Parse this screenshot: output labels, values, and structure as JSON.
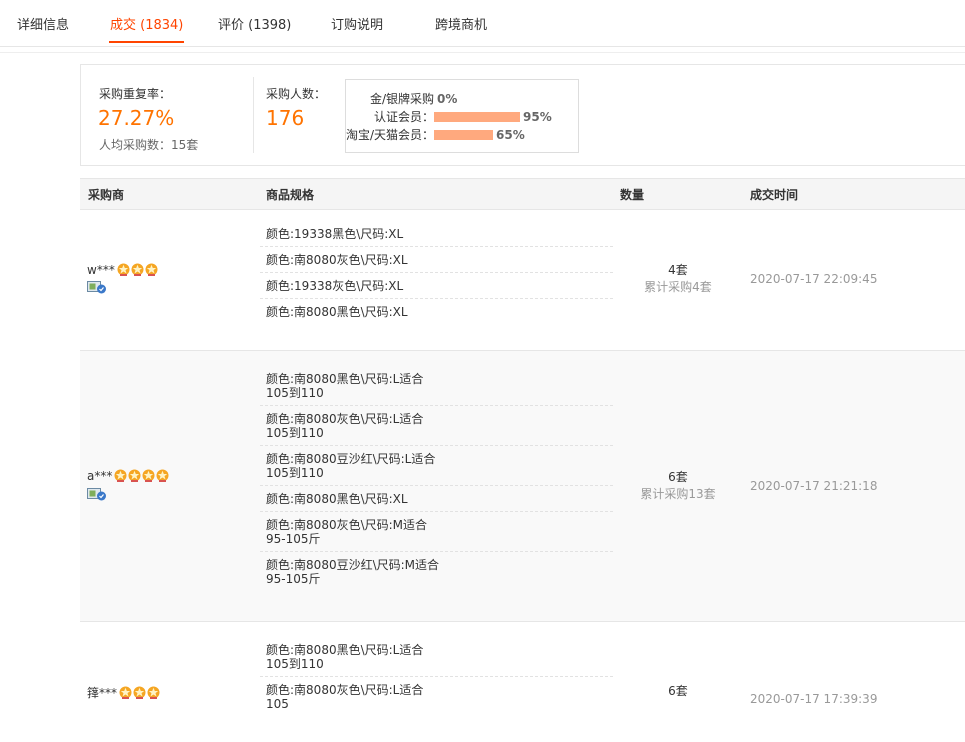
{
  "tabs": [
    {
      "label": "详细信息"
    },
    {
      "label": "成交 (1834)",
      "active": true
    },
    {
      "label": "评价 (1398)"
    },
    {
      "label": "订购说明"
    },
    {
      "label": "跨境商机"
    }
  ],
  "summary": {
    "repeat_rate_label": "采购重复率：",
    "repeat_rate_value": "27.27%",
    "per_capita": "人均采购数：15套",
    "buyers_label": "采购人数：",
    "buyers_value": "176",
    "distribution": [
      {
        "label": "金/银牌采购",
        "pct": "0%",
        "value": 0
      },
      {
        "label": "认证会员：",
        "pct": "95%",
        "value": 95
      },
      {
        "label": "淘宝/天猫会员：",
        "pct": "65%",
        "value": 65
      }
    ]
  },
  "table": {
    "headers": {
      "buyer": "采购商",
      "spec": "商品规格",
      "qty": "数量",
      "time": "成交时间"
    },
    "rows": [
      {
        "buyer": "w***",
        "stars": 3,
        "specs": [
          "颜色:19338黑色\\尺码:XL",
          "颜色:南8080灰色\\尺码:XL",
          "颜色:19338灰色\\尺码:XL",
          "颜色:南8080黑色\\尺码:XL"
        ],
        "qty": "4套",
        "qty_total": "累计采购4套",
        "time": "2020-07-17 22:09:45"
      },
      {
        "buyer": "a***",
        "stars": 4,
        "specs": [
          "颜色:南8080黑色\\尺码:L适合105到110",
          "颜色:南8080灰色\\尺码:L适合105到110",
          "颜色:南8080豆沙红\\尺码:L适合105到110",
          "颜色:南8080黑色\\尺码:XL",
          "颜色:南8080灰色\\尺码:M适合95-105斤",
          "颜色:南8080豆沙红\\尺码:M适合95-105斤"
        ],
        "qty": "6套",
        "qty_total": "累计采购13套",
        "time": "2020-07-17 21:21:18"
      },
      {
        "buyer": "箨***",
        "stars": 3,
        "specs": [
          "颜色:南8080黑色\\尺码:L适合105到110",
          "颜色:南8080灰色\\尺码:L适合105"
        ],
        "qty": "6套",
        "qty_total": "",
        "time": "2020-07-17 17:39:39"
      }
    ]
  },
  "colors": {
    "accent": "#ff4400",
    "orange": "#ff7300",
    "bar": "#ffa97e",
    "star": "#f5a623"
  }
}
